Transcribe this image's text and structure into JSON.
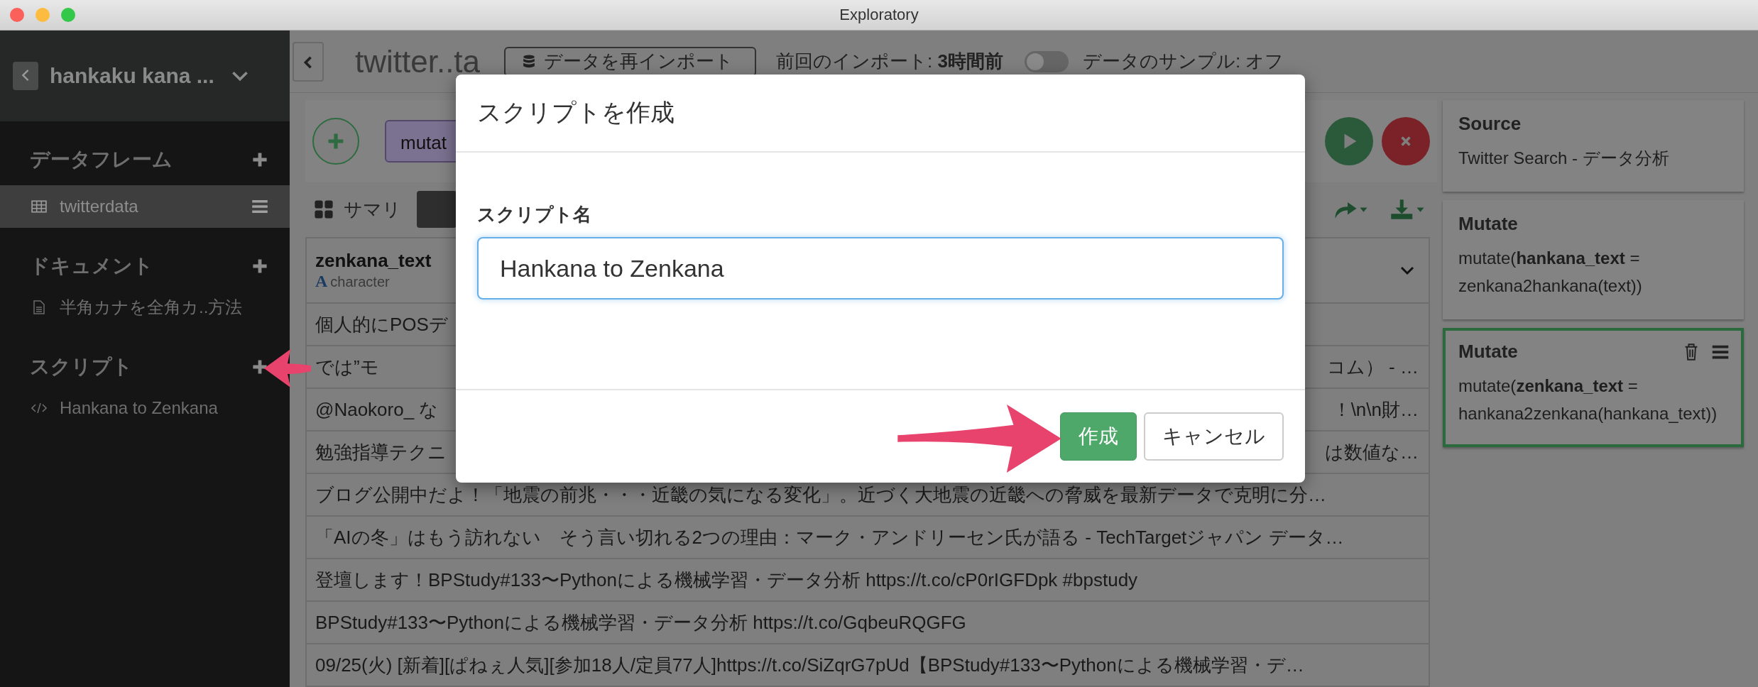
{
  "window": {
    "title": "Exploratory"
  },
  "sidebar": {
    "project": "hankaku kana ...",
    "sections": [
      {
        "kind": "dataframes",
        "title": "データフレーム",
        "items": [
          {
            "label": "twitterdata",
            "selected": true
          }
        ]
      },
      {
        "kind": "documents",
        "title": "ドキュメント",
        "items": [
          {
            "label": "半角カナを全角カ..方法",
            "selected": false
          }
        ]
      },
      {
        "kind": "scripts",
        "title": "スクリプト",
        "items": [
          {
            "label": "Hankana to Zenkana",
            "selected": false
          }
        ]
      }
    ]
  },
  "toolbar": {
    "dataframe_name": "twitter..ta",
    "reimport_button": "データを再インポート",
    "last_import_label": "前回のインポート:",
    "last_import_value": "3時間前",
    "sample_toggle": {
      "label": "データのサンプル: オフ",
      "on": false
    }
  },
  "pipeline": {
    "step_chip": "mutat"
  },
  "view_tabs": [
    {
      "kind": "summary",
      "label": "サマリ",
      "selected": false
    },
    {
      "kind": "table",
      "selected": true
    }
  ],
  "table": {
    "columns": [
      {
        "name": "zenkana_text",
        "type_icon": "A",
        "type": "character"
      }
    ],
    "rows": [
      {
        "start": "個人的にPOSデ"
      },
      {
        "start": "では”モ",
        "end": "コム） - …"
      },
      {
        "start": "@Naokoro_ な",
        "end": "！\\n\\n財…"
      },
      {
        "start": "勉強指導テクニ",
        "end": "は数値な…"
      },
      {
        "start": "ブログ公開中だよ！「地震の前兆・・・近畿の気になる変化」。近づく大地震の近畿への脅威を最新データで克明に分…"
      },
      {
        "start": "「AIの冬」はもう訪れない　そう言い切れる2つの理由：マーク・アンドリーセン氏が語る - TechTargetジャパン データ…"
      },
      {
        "start": "登壇します！BPStudy#133〜Pythonによる機械学習・データ分析 https://t.co/cP0rIGFDpk #bpstudy"
      },
      {
        "start": "BPStudy#133〜Pythonによる機械学習・データ分析 https://t.co/GqbeuRQGFG"
      },
      {
        "start": "09/25(火) [新着][ぱねぇ人気][参加18人/定員77人]https://t.co/SiZqrG7pUd【BPStudy#133〜Pythonによる機械学習・デ…"
      }
    ]
  },
  "steps": [
    {
      "title": "Source",
      "text": "Twitter Search - データ分析",
      "selected": false
    },
    {
      "title": "Mutate",
      "text": "mutate(**hankana_text** = zenkana2hankana(text))",
      "selected": false
    },
    {
      "title": "Mutate",
      "text": "mutate(**zenkana_text** = hankana2zenkana(hankana_text))",
      "selected": true
    }
  ],
  "dialog": {
    "title": "スクリプトを作成",
    "field_label": "スクリプト名",
    "value": "Hankana to Zenkana",
    "buttons": [
      {
        "kind": "primary",
        "label": "作成"
      },
      {
        "kind": "secondary",
        "label": "キャンセル"
      }
    ]
  }
}
